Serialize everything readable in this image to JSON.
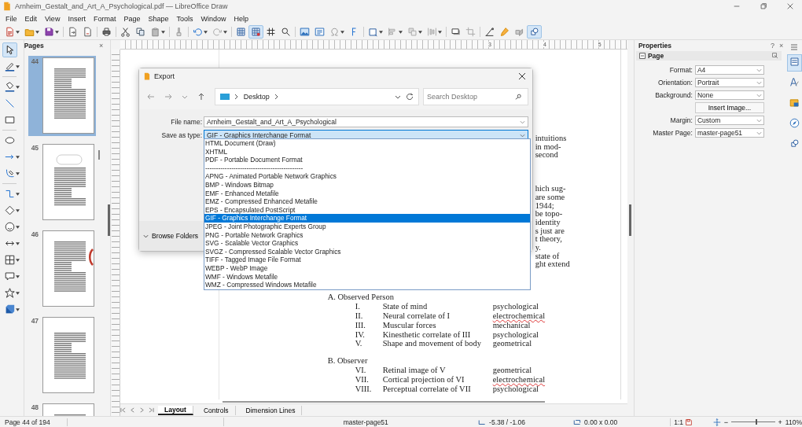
{
  "window": {
    "title": "Arnheim_Gestalt_and_Art_A_Psychological.pdf — LibreOffice Draw"
  },
  "menu": [
    "File",
    "Edit",
    "View",
    "Insert",
    "Format",
    "Page",
    "Shape",
    "Tools",
    "Window",
    "Help"
  ],
  "toolbar": [
    {
      "on": false
    },
    {
      "on": false
    },
    {
      "on": false
    },
    {
      "on": false
    },
    {
      "on": false
    },
    {
      "on": false
    },
    {
      "on": false
    },
    {
      "on": false
    },
    {
      "on": false
    },
    {
      "on": false
    },
    {
      "on": false
    },
    {
      "on": false
    },
    {
      "on": false
    },
    {
      "on": true
    },
    {
      "on": false
    },
    {
      "on": false
    },
    {
      "on": false
    },
    {
      "on": false
    },
    {
      "on": false
    },
    {
      "on": false
    },
    {
      "on": false
    },
    {
      "on": false
    },
    {
      "on": false
    },
    {
      "on": false
    },
    {
      "on": false
    },
    {
      "on": false
    },
    {
      "on": false
    },
    {
      "on": false
    },
    {
      "on": false
    },
    {
      "on": true
    }
  ],
  "tools": [
    {
      "selected": true
    },
    {
      "selected": false
    },
    {
      "selected": false
    },
    {
      "selected": false
    },
    {
      "selected": false
    },
    {
      "selected": false
    },
    {
      "selected": false
    },
    {
      "selected": false
    },
    {
      "selected": false
    },
    {
      "selected": false
    },
    {
      "selected": false
    },
    {
      "selected": false
    },
    {
      "selected": false
    },
    {
      "selected": false
    },
    {
      "selected": false
    },
    {
      "selected": false
    }
  ],
  "pages_panel": {
    "title": "Pages",
    "close": "×",
    "pages": [
      {
        "number": "44",
        "selected": true
      },
      {
        "number": "45",
        "selected": false
      },
      {
        "number": "46",
        "selected": false
      },
      {
        "number": "47",
        "selected": false
      },
      {
        "number": "48",
        "selected": false
      }
    ]
  },
  "ruler_labels": [
    "3",
    "4",
    "5"
  ],
  "document": {
    "text_blocks": [
      [
        "intuitions",
        "in mod-",
        "second"
      ],
      [
        "hich sug-",
        "are some",
        "1944;",
        "be topo-",
        "identity",
        "s just are",
        "t theory,",
        "y.",
        "state of",
        "ght extend"
      ]
    ],
    "outline": [
      {
        "heading": "A. Observed Person",
        "rows": [
          {
            "numeral": "I.",
            "text": "State of mind",
            "type": "psychological",
            "spell_error": false
          },
          {
            "numeral": "II.",
            "text": "Neural correlate of I",
            "type": "electrochemical",
            "spell_error": true
          },
          {
            "numeral": "III.",
            "text": "Muscular forces",
            "type": "mechanical",
            "spell_error": false
          },
          {
            "numeral": "IV.",
            "text": "Kinesthetic correlate of III",
            "type": "psychological",
            "spell_error": false
          },
          {
            "numeral": "V.",
            "text": "Shape and movement of body",
            "type": "geometrical",
            "spell_error": false
          }
        ]
      },
      {
        "heading": "B. Observer",
        "rows": [
          {
            "numeral": "VI.",
            "text": "Retinal image of V",
            "type": "geometrical",
            "spell_error": false
          },
          {
            "numeral": "VII.",
            "text": "Cortical projection of VI",
            "type": "electrochemical",
            "spell_error": true
          },
          {
            "numeral": "VIII.",
            "text": "Perceptual correlate of VII",
            "type": "psychological",
            "spell_error": false
          }
        ]
      }
    ]
  },
  "canvas_tabs": [
    {
      "label": "Layout",
      "selected": true
    },
    {
      "label": "Controls",
      "selected": false
    },
    {
      "label": "Dimension Lines",
      "selected": false
    }
  ],
  "save_dialog": {
    "title": "Export",
    "location": "Desktop",
    "search_placeholder": "Search Desktop",
    "file_name_label": "File name:",
    "file_name": "Arnheim_Gestalt_and_Art_A_Psychological",
    "type_label": "Save as type:",
    "type_value": "GIF - Graphics Interchange Format",
    "browse_folders": "Browse Folders",
    "type_options": [
      {
        "label": "HTML Document (Draw)",
        "selected": false
      },
      {
        "label": "XHTML",
        "selected": false
      },
      {
        "label": "PDF - Portable Document Format",
        "selected": false
      },
      {
        "label": "---------------------------------------------",
        "selected": false
      },
      {
        "label": "APNG - Animated Portable Network Graphics",
        "selected": false
      },
      {
        "label": "BMP - Windows Bitmap",
        "selected": false
      },
      {
        "label": "EMF - Enhanced Metafile",
        "selected": false
      },
      {
        "label": "EMZ - Compressed Enhanced Metafile",
        "selected": false
      },
      {
        "label": "EPS - Encapsulated PostScript",
        "selected": false
      },
      {
        "label": "GIF - Graphics Interchange Format",
        "selected": true
      },
      {
        "label": "JPEG - Joint Photographic Experts Group",
        "selected": false
      },
      {
        "label": "PNG - Portable Network Graphics",
        "selected": false
      },
      {
        "label": "SVG - Scalable Vector Graphics",
        "selected": false
      },
      {
        "label": "SVGZ - Compressed Scalable Vector Graphics",
        "selected": false
      },
      {
        "label": "TIFF - Tagged Image File Format",
        "selected": false
      },
      {
        "label": "WEBP - WebP Image",
        "selected": false
      },
      {
        "label": "WMF - Windows Metafile",
        "selected": false
      },
      {
        "label": "WMZ - Compressed Windows Metafile",
        "selected": false
      }
    ]
  },
  "properties": {
    "title": "Properties",
    "help": "?",
    "close": "×",
    "section": "Page",
    "fields": [
      {
        "label": "Format:",
        "value": "A4"
      },
      {
        "label": "Orientation:",
        "value": "Portrait"
      },
      {
        "label": "Background:",
        "value": "None"
      }
    ],
    "insert_image": "Insert Image...",
    "fields_2": [
      {
        "label": "Margin:",
        "value": "Custom"
      },
      {
        "label": "Master Page:",
        "value": "master-page51"
      }
    ]
  },
  "sidebar_tabs": [
    {
      "selected": true
    },
    {
      "selected": false
    },
    {
      "selected": false
    },
    {
      "selected": false
    },
    {
      "selected": false
    }
  ],
  "status_bar": {
    "page": "Page 44 of 194",
    "master_page": "master-page51",
    "position": "-5.38 / -1.06",
    "size": "0.00 x 0.00",
    "scale": "1:1",
    "zoom_out": "−",
    "zoom_in": "+",
    "zoom_slider": {
      "level": 0.55
    },
    "zoom": "110%"
  }
}
